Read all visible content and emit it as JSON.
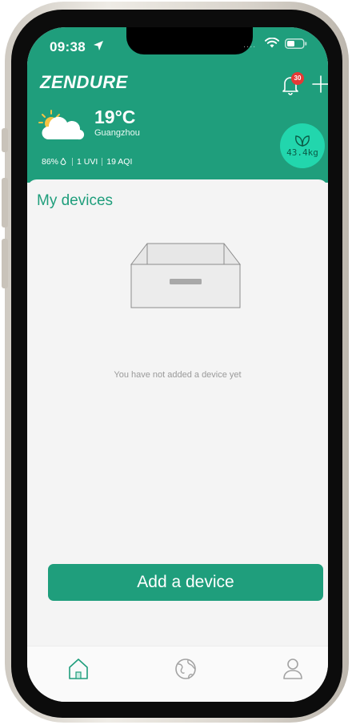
{
  "status_bar": {
    "time": "09:38"
  },
  "header": {
    "brand": "ZENDURE",
    "notification_count": "30",
    "weather": {
      "temperature": "19°C",
      "city": "Guangzhou",
      "humidity": "86%",
      "uvi": "1 UVI",
      "aqi": "19 AQI",
      "icon": "partly-cloudy-icon"
    },
    "carbon": {
      "value": "43.4kg",
      "icon": "leaf-icon"
    }
  },
  "main": {
    "title": "My devices",
    "empty_message": "You have not added a device yet",
    "add_device_label": "Add a device"
  },
  "tabbar": {
    "tabs": [
      {
        "icon": "home-icon",
        "active": true
      },
      {
        "icon": "globe-icon",
        "active": false
      },
      {
        "icon": "profile-icon",
        "active": false
      }
    ]
  },
  "colors": {
    "brand": "#1f9e7c",
    "accent": "#22d6ad",
    "badge": "#e53935"
  }
}
